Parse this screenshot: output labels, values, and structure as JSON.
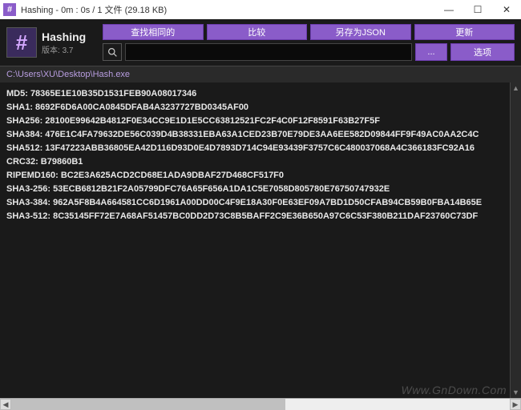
{
  "titlebar": {
    "icon_char": "#",
    "title": "Hashing - 0m : 0s / 1 文件 (29.18 KB)"
  },
  "app": {
    "icon_char": "#",
    "name": "Hashing",
    "version_label": "版本:",
    "version": "3.7"
  },
  "buttons": {
    "find_same": "查找相同的",
    "compare": "比较",
    "save_json": "另存为JSON",
    "refresh": "更新",
    "browse": "...",
    "options": "选项"
  },
  "search": {
    "placeholder": ""
  },
  "path": "C:\\Users\\XU\\Desktop\\Hash.exe",
  "hashes": [
    {
      "algo": "MD5",
      "value": "78365E1E10B35D1531FEB90A08017346"
    },
    {
      "algo": "SHA1",
      "value": "8692F6D6A00CA0845DFAB4A3237727BD0345AF00"
    },
    {
      "algo": "SHA256",
      "value": "28100E99642B4812F0E34CC9E1D1E5CC63812521FC2F4C0F12F8591F63B27F5F"
    },
    {
      "algo": "SHA384",
      "value": "476E1C4FA79632DE56C039D4B38331EBA63A1CED23B70E79DE3AA6EE582D09844FF9F49AC0AA2C4C"
    },
    {
      "algo": "SHA512",
      "value": "13F47223ABB36805EA42D116D93D0E4D7893D714C94E93439F3757C6C480037068A4C366183FC92A16"
    },
    {
      "algo": "CRC32",
      "value": "B79860B1"
    },
    {
      "algo": "RIPEMD160",
      "value": "BC2E3A625ACD2CD68E1ADA9DBAF27D468CF517F0"
    },
    {
      "algo": "SHA3-256",
      "value": "53ECB6812B21F2A05799DFC76A65F656A1DA1C5E7058D805780E76750747932E"
    },
    {
      "algo": "SHA3-384",
      "value": "962A5F8B4A664581CC6D1961A00DD00C4F9E18A30F0E63EF09A7BD1D50CFAB94CB59B0FBA14B65E"
    },
    {
      "algo": "SHA3-512",
      "value": "8C35145FF72E7A68AF51457BC0DD2D73C8B5BAFF2C9E36B650A97C6C53F380B211DAF23760C73DF"
    }
  ],
  "watermark": "Www.GnDown.Com"
}
